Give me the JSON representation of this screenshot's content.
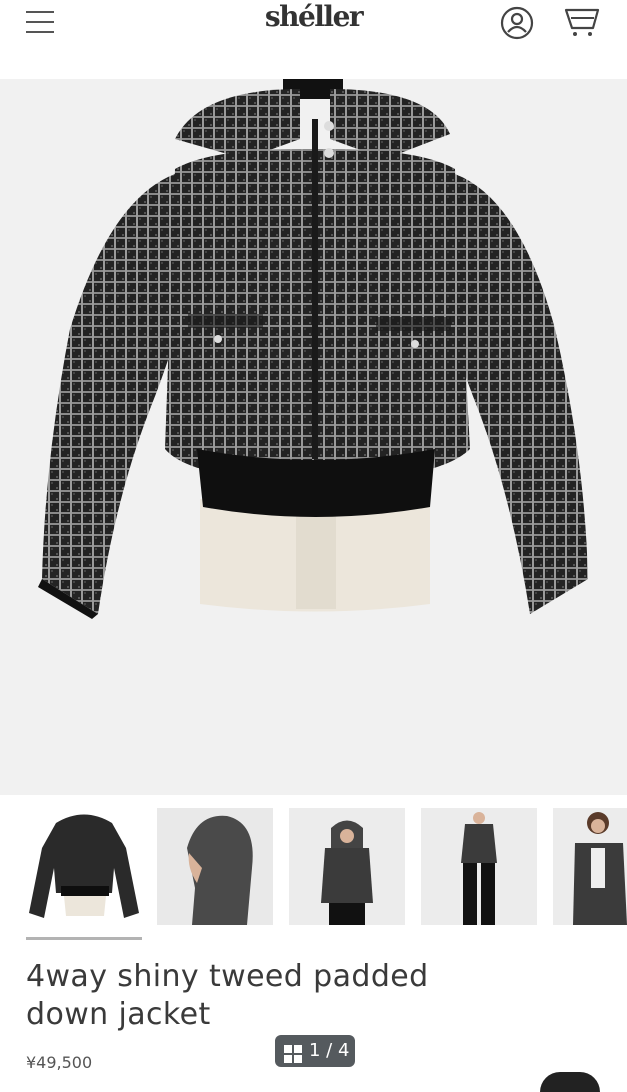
{
  "header": {
    "logo": "shéller",
    "menu_icon": "hamburger-menu-icon",
    "account_icon": "user-circle-icon",
    "cart_icon": "shopping-cart-icon"
  },
  "product": {
    "title": "4way shiny tweed padded down jacket",
    "price": "¥49,500",
    "image_counter": "1 / 4",
    "counter_icon": "grid-icon"
  },
  "gallery": {
    "thumbnails": [
      {
        "label": "jacket-front"
      },
      {
        "label": "hood-back"
      },
      {
        "label": "vest-model"
      },
      {
        "label": "vest-full-length"
      },
      {
        "label": "jacket-model"
      }
    ],
    "selected_index": 0
  },
  "colors": {
    "tweed": "#2b2b2b",
    "background": "#f1f1f1",
    "accent": "#555a5e"
  }
}
